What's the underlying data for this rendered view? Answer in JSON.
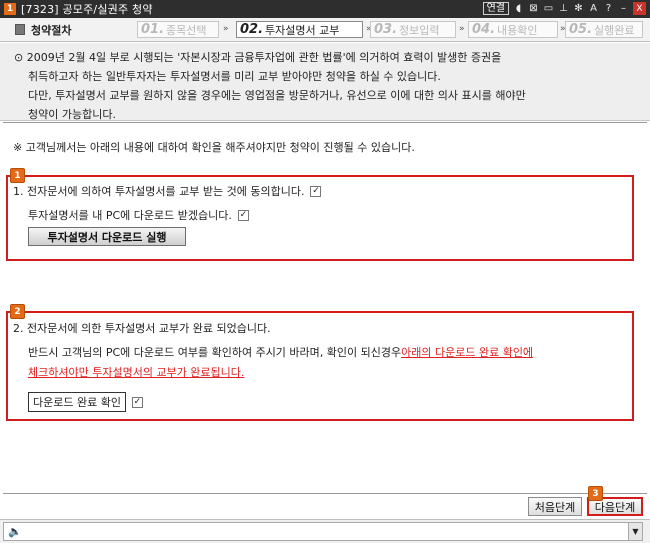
{
  "window": {
    "number_badge": "1",
    "title": "[7323] 공모주/실권주 청약",
    "buttons": {
      "link": "연결",
      "close": "X"
    }
  },
  "steps": {
    "header": "청약절차",
    "items": [
      {
        "num": "01.",
        "label": "종목선택",
        "active": false
      },
      {
        "num": "02.",
        "label": "투자설명서 교부",
        "active": true
      },
      {
        "num": "03.",
        "label": "정보입력",
        "active": false
      },
      {
        "num": "04.",
        "label": "내용확인",
        "active": false
      },
      {
        "num": "05.",
        "label": "실행완료",
        "active": false
      }
    ],
    "separator": "»"
  },
  "notice": {
    "bullet": "⊙",
    "line1": "2009년 2월 4일 부로 시행되는 '자본시장과 금융투자업에 관한 법률'에 의거하여 효력이 발생한 증권을",
    "line2": "취득하고자 하는 일반투자자는 투자설명서를 미리 교부 받아야만 청약을 하실 수 있습니다.",
    "line3": "다만, 투자설명서 교부를 원하지 않을 경우에는 영업점을 방문하거나, 유선으로 이에 대한 의사 표시를 해야만",
    "line4": "청약이 가능합니다."
  },
  "main": {
    "intro": "※ 고객님께서는 아래의 내용에 대하여 확인을 해주셔야지만 청약이 진행될 수 있습니다.",
    "section1": {
      "badge": "1",
      "line1": "1. 전자문서에 의하여 투자설명서를 교부 받는 것에 동의합니다.",
      "line2": "투자설명서를 내 PC에 다운로드 받겠습니다.",
      "checked1": "✓",
      "checked2": "✓",
      "button": "투자설명서 다운로드 실행"
    },
    "section2": {
      "badge": "2",
      "line1": "2. 전자문서에 의한 투자설명서 교부가 완료 되었습니다.",
      "line2_plain": "반드시 고객님의 PC에 다운로드 여부를 확인하여 주시기 바라며, 확인이 되신경우 ",
      "line2_red": "아래의 다운로드 완료 확인에",
      "line3_red": "체크하셔야만 투자설명서의 교부가 완료됩니다.",
      "confirm_label": "다운로드 완료 확인",
      "checked": "✓"
    }
  },
  "footer": {
    "badge": "3",
    "first_step": "처음단계",
    "next_step": "다음단계"
  },
  "status": {
    "speaker": "🔈",
    "dropdown": "▼"
  }
}
